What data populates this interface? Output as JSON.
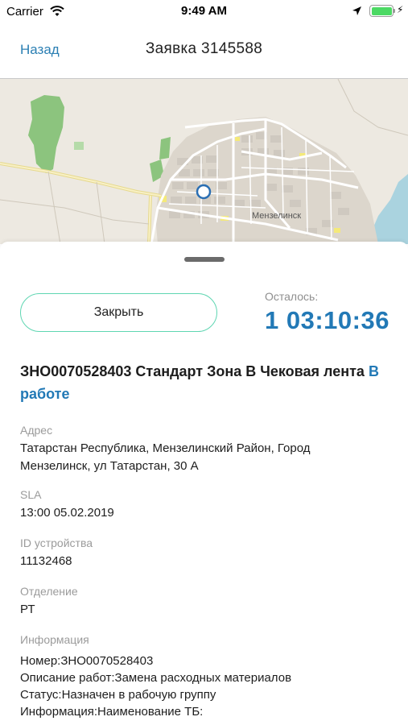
{
  "status_bar": {
    "carrier": "Carrier",
    "time": "9:49 AM",
    "battery_color": "#4cd964",
    "icons": [
      "wifi-icon",
      "location-arrow-icon",
      "battery-icon",
      "charging-bolt-icon"
    ]
  },
  "nav": {
    "back_label": "Назад",
    "title": "Заявка 3145588"
  },
  "map": {
    "city_label": "Мензелинск",
    "colors": {
      "land": "#ede9e1",
      "park": "#8cc47e",
      "road": "#ffffff",
      "highway": "#f2e6a8",
      "marker": "#2b6fb3"
    }
  },
  "sheet": {
    "close_label": "Закрыть",
    "remaining_label": "Осталось:",
    "remaining_value": "1 03:10:36",
    "accent": "#2279b6",
    "button_border": "#5fd6b2"
  },
  "order": {
    "title": "ЗНО0070528403 Стандарт Зона В Чековая лента",
    "status": "В работе"
  },
  "fields": {
    "address": {
      "label": "Адрес",
      "line1": "Татарстан Республика, Мензелинский Район, Город",
      "line2": "Мензелинск, ул Татарстан,  30 А"
    },
    "sla": {
      "label": "SLA",
      "value": "13:00 05.02.2019"
    },
    "device": {
      "label": "ID устройства",
      "value": "11132468"
    },
    "department": {
      "label": "Отделение",
      "value": "РТ"
    },
    "info": {
      "label": "Информация",
      "lines": [
        "Номер:ЗНО0070528403",
        "Описание работ:Замена расходных материалов",
        "Статус:Назначен в рабочую группу",
        "Информация:Наименование ТБ:"
      ]
    }
  }
}
